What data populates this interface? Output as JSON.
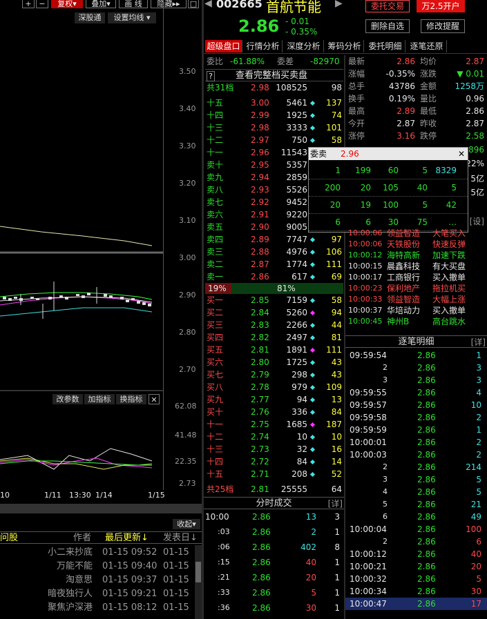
{
  "left": {
    "toolbar": {
      "plus": "+",
      "minus": "−",
      "fuquan": "复权",
      "diejia": "叠加",
      "huaxian": "画 线",
      "yincang": "隐藏",
      "more": "▸▸",
      "box": "□"
    },
    "top_buttons": {
      "shengutong": "深股通",
      "set_avg": "设置均线"
    },
    "price_ticks": [
      "3.50",
      "3.40",
      "3.30",
      "3.20",
      "3.10",
      "3.00",
      "2.90",
      "2.80",
      "2.70"
    ],
    "ind_buttons": {
      "gaicanshu": "改参数",
      "jiazhibiao": "加指标",
      "huanzhibiao": "换指标",
      "close": "✕"
    },
    "ind_ticks": [
      "62.08",
      "41.48",
      "22.35",
      "2.73"
    ],
    "date_ticks": [
      "10",
      "1/11",
      "13:30",
      "1/14",
      "1/15"
    ],
    "collapse": "收起",
    "guba": {
      "tab": "问股",
      "author": "作者",
      "last_update": "最后更新↓",
      "post_time": "发表日↓",
      "rows": [
        {
          "author": "小二来抄底",
          "update": "01-15 09:52",
          "post": "01-15"
        },
        {
          "author": "万能不能",
          "update": "01-15 09:40",
          "post": "01-15"
        },
        {
          "author": "淘意思",
          "update": "01-15 09:37",
          "post": "01-15"
        },
        {
          "author": "暗夜独行人",
          "update": "01-15 09:21",
          "post": "01-15"
        },
        {
          "author": "聚焦沪深港",
          "update": "01-15 08:12",
          "post": "01-15"
        }
      ]
    }
  },
  "stock": {
    "code": "002665",
    "name": "首航节能",
    "price": "2.86",
    "change": "- 0.01",
    "change_pct": "- 0.35%",
    "btn_trade": "委托交易",
    "btn_open": "万2.5开户",
    "btn_delete": "删除自选",
    "btn_alert": "修改提醒"
  },
  "tabs": [
    "超级盘口",
    "行情分析",
    "深度分析",
    "筹码分析",
    "委托明细",
    "逐笔还原"
  ],
  "book": {
    "weibi_label": "委比",
    "weibi": "-61.88%",
    "weicha_label": "委差",
    "weicha": "-82970",
    "q": "?",
    "full_link": "查看完整档买卖盘",
    "sell_total": {
      "label": "共31档",
      "price": "2.98",
      "vol": "108525",
      "n": "98"
    },
    "sells": [
      {
        "label": "十五",
        "price": "3.00",
        "vol": "5461",
        "dot": "cyan",
        "n": "137"
      },
      {
        "label": "十四",
        "price": "2.99",
        "vol": "1925",
        "dot": "cyan",
        "n": "74"
      },
      {
        "label": "十三",
        "price": "2.98",
        "vol": "3333",
        "dot": "cyan",
        "n": "101"
      },
      {
        "label": "十二",
        "price": "2.97",
        "vol": "750",
        "dot": "cyan",
        "n": "58"
      },
      {
        "label": "十一",
        "price": "2.96",
        "vol": "11543",
        "dot": "",
        "n": ""
      },
      {
        "label": "卖十",
        "price": "2.95",
        "vol": "5357",
        "dot": "",
        "n": ""
      },
      {
        "label": "卖九",
        "price": "2.94",
        "vol": "2859",
        "dot": "",
        "n": ""
      },
      {
        "label": "卖八",
        "price": "2.93",
        "vol": "5526",
        "dot": "",
        "n": ""
      },
      {
        "label": "卖七",
        "price": "2.92",
        "vol": "9452",
        "dot": "",
        "n": ""
      },
      {
        "label": "卖六",
        "price": "2.91",
        "vol": "9220",
        "dot": "",
        "n": ""
      },
      {
        "label": "卖五",
        "price": "2.90",
        "vol": "9005",
        "dot": "",
        "n": ""
      },
      {
        "label": "卖四",
        "price": "2.89",
        "vol": "7747",
        "dot": "cyan",
        "n": "97"
      },
      {
        "label": "卖三",
        "price": "2.88",
        "vol": "4976",
        "dot": "cyan",
        "n": "106"
      },
      {
        "label": "卖二",
        "price": "2.87",
        "vol": "1774",
        "dot": "cyan",
        "n": "111"
      },
      {
        "label": "卖一",
        "price": "2.86",
        "vol": "617",
        "dot": "cyan",
        "n": "69"
      }
    ],
    "ratio_left": "19%",
    "ratio_right": "81%",
    "buys": [
      {
        "label": "买一",
        "price": "2.85",
        "vol": "7159",
        "dot": "cyan",
        "n": "58"
      },
      {
        "label": "买二",
        "price": "2.84",
        "vol": "5260",
        "dot": "pur",
        "n": "94"
      },
      {
        "label": "买三",
        "price": "2.83",
        "vol": "2266",
        "dot": "cyan",
        "n": "44"
      },
      {
        "label": "买四",
        "price": "2.82",
        "vol": "2497",
        "dot": "cyan",
        "n": "81"
      },
      {
        "label": "买五",
        "price": "2.81",
        "vol": "1891",
        "dot": "pur",
        "n": "111"
      },
      {
        "label": "买六",
        "price": "2.80",
        "vol": "1725",
        "dot": "cyan",
        "n": "43"
      },
      {
        "label": "买七",
        "price": "2.79",
        "vol": "298",
        "dot": "cyan",
        "n": "43"
      },
      {
        "label": "买八",
        "price": "2.78",
        "vol": "979",
        "dot": "cyan",
        "n": "109"
      },
      {
        "label": "买九",
        "price": "2.77",
        "vol": "94",
        "dot": "cyan",
        "n": "13"
      },
      {
        "label": "买十",
        "price": "2.76",
        "vol": "336",
        "dot": "cyan",
        "n": "84"
      },
      {
        "label": "十一",
        "price": "2.75",
        "vol": "1685",
        "dot": "pur",
        "n": "187"
      },
      {
        "label": "十二",
        "price": "2.74",
        "vol": "10",
        "dot": "cyan",
        "n": "10"
      },
      {
        "label": "十三",
        "price": "2.73",
        "vol": "32",
        "dot": "cyan",
        "n": "16"
      },
      {
        "label": "十四",
        "price": "2.72",
        "vol": "84",
        "dot": "cyan",
        "n": "14"
      },
      {
        "label": "十五",
        "price": "2.71",
        "vol": "208",
        "dot": "cyan",
        "n": "52"
      }
    ],
    "buy_total": {
      "label": "共25档",
      "price": "2.81",
      "vol": "25555",
      "n": "64"
    }
  },
  "popup": {
    "title": "委卖",
    "price": "2.96",
    "close": "✕",
    "rows": [
      [
        "1",
        "199",
        "60",
        "5",
        "8329"
      ],
      [
        "200",
        "20",
        "105",
        "40",
        "5"
      ],
      [
        "20",
        "19",
        "100",
        "5",
        "42"
      ],
      [
        "6",
        "6",
        "30",
        "75",
        "…"
      ]
    ]
  },
  "quote": [
    {
      "l1": "最新",
      "v1": "2.86",
      "c1": "red",
      "l2": "均价",
      "v2": "2.87",
      "c2": "red"
    },
    {
      "l1": "涨幅",
      "v1": "-0.35%",
      "c1": "wht",
      "l2": "涨跌",
      "v2": "▼ 0.01",
      "c2": "grn"
    },
    {
      "l1": "总手",
      "v1": "43786",
      "c1": "wht",
      "l2": "金额",
      "v2": "1258万",
      "c2": "cyan"
    },
    {
      "l1": "换手",
      "v1": "0.19%",
      "c1": "wht",
      "l2": "量比",
      "v2": "0.96",
      "c2": "wht"
    },
    {
      "l1": "最高",
      "v1": "2.89",
      "c1": "red",
      "l2": "最低",
      "v2": "2.86",
      "c2": "wht"
    },
    {
      "l1": "今开",
      "v1": "2.87",
      "c1": "wht",
      "l2": "昨收",
      "v2": "2.87",
      "c2": "wht"
    },
    {
      "l1": "涨停",
      "v1": "3.16",
      "c1": "red",
      "l2": "跌停",
      "v2": "2.58",
      "c2": "grn"
    }
  ],
  "quote_partial": [
    {
      "text": "896",
      "color": "grn"
    },
    {
      "text": "22%",
      "color": "wht"
    },
    {
      "text": "5亿",
      "color": "wht"
    },
    {
      "text": "5亿",
      "color": "wht"
    },
    {
      "text": "[设]",
      "color": "gry"
    }
  ],
  "alerts": [
    {
      "time": "10:00:06",
      "stock": "领益智造",
      "event": "大笔买入",
      "color": "red"
    },
    {
      "time": "10:00:06",
      "stock": "天铁股份",
      "event": "快速反弹",
      "color": "red"
    },
    {
      "time": "10:00:12",
      "stock": "海特高新",
      "event": "加速下跌",
      "color": "grn"
    },
    {
      "time": "10:00:15",
      "stock": "晨鑫科技",
      "event": "有大买盘",
      "color": "wht"
    },
    {
      "time": "10:00:17",
      "stock": "工商银行",
      "event": "买入撤单",
      "color": "wht"
    },
    {
      "time": "10:00:23",
      "stock": "保利地产",
      "event": "拖拉机买",
      "color": "red"
    },
    {
      "time": "10:00:33",
      "stock": "领益智造",
      "event": "大幅上涨",
      "color": "red"
    },
    {
      "time": "10:00:37",
      "stock": "华培动力",
      "event": "买入撤单",
      "color": "wht"
    },
    {
      "time": "10:00:45",
      "stock": "神州B",
      "event": "高台跳水",
      "color": "grn"
    }
  ],
  "zhubi": {
    "title": "逐笔明细",
    "detail": "[详]",
    "rows": [
      {
        "t": "09:59:54",
        "p": "2.86",
        "v": "1",
        "vc": "cyan"
      },
      {
        "t": "2",
        "p": "2.86",
        "v": "3",
        "vc": "cyan"
      },
      {
        "t": "3",
        "p": "2.86",
        "v": "3",
        "vc": "cyan"
      },
      {
        "t": "09:59:55",
        "p": "2.86",
        "v": "4",
        "vc": "cyan"
      },
      {
        "t": "09:59:57",
        "p": "2.86",
        "v": "10",
        "vc": "cyan"
      },
      {
        "t": "09:59:58",
        "p": "2.86",
        "v": "2",
        "vc": "cyan"
      },
      {
        "t": "09:59:59",
        "p": "2.86",
        "v": "1",
        "vc": "cyan"
      },
      {
        "t": "10:00:01",
        "p": "2.86",
        "v": "2",
        "vc": "cyan"
      },
      {
        "t": "10:00:03",
        "p": "2.86",
        "v": "2",
        "vc": "cyan"
      },
      {
        "t": "2",
        "p": "2.86",
        "v": "214",
        "vc": "cyan"
      },
      {
        "t": "3",
        "p": "2.86",
        "v": "5",
        "vc": "cyan"
      },
      {
        "t": "4",
        "p": "2.86",
        "v": "5",
        "vc": "cyan"
      },
      {
        "t": "5",
        "p": "2.86",
        "v": "21",
        "vc": "cyan"
      },
      {
        "t": "6",
        "p": "2.86",
        "v": "49",
        "vc": "cyan"
      },
      {
        "t": "10:00:04",
        "p": "2.86",
        "v": "100",
        "vc": "red"
      },
      {
        "t": "2",
        "p": "2.86",
        "v": "6",
        "vc": "red"
      },
      {
        "t": "10:00:12",
        "p": "2.86",
        "v": "40",
        "vc": "red"
      },
      {
        "t": "10:00:21",
        "p": "2.86",
        "v": "20",
        "vc": "red"
      },
      {
        "t": "10:00:32",
        "p": "2.86",
        "v": "5",
        "vc": "red"
      },
      {
        "t": "10:00:34",
        "p": "2.86",
        "v": "30",
        "vc": "red"
      },
      {
        "t": "10:00:47",
        "p": "2.86",
        "v": "17",
        "vc": "red"
      }
    ]
  },
  "fenshi": {
    "title": "分时成交",
    "detail": "[详]",
    "rows": [
      {
        "t": "10:00",
        "p": "2.86",
        "v": "13",
        "vc": "cyan",
        "n": "3"
      },
      {
        "t": ":03",
        "p": "2.86",
        "v": "2",
        "vc": "cyan",
        "n": "1"
      },
      {
        "t": ":06",
        "p": "2.86",
        "v": "402",
        "vc": "cyan",
        "n": "8"
      },
      {
        "t": ":15",
        "p": "2.86",
        "v": "40",
        "vc": "red",
        "n": "1"
      },
      {
        "t": ":21",
        "p": "2.86",
        "v": "20",
        "vc": "red",
        "n": "1"
      },
      {
        "t": ":33",
        "p": "2.86",
        "v": "5",
        "vc": "red",
        "n": "1"
      },
      {
        "t": ":36",
        "p": "2.86",
        "v": "30",
        "vc": "red",
        "n": "1"
      }
    ]
  }
}
